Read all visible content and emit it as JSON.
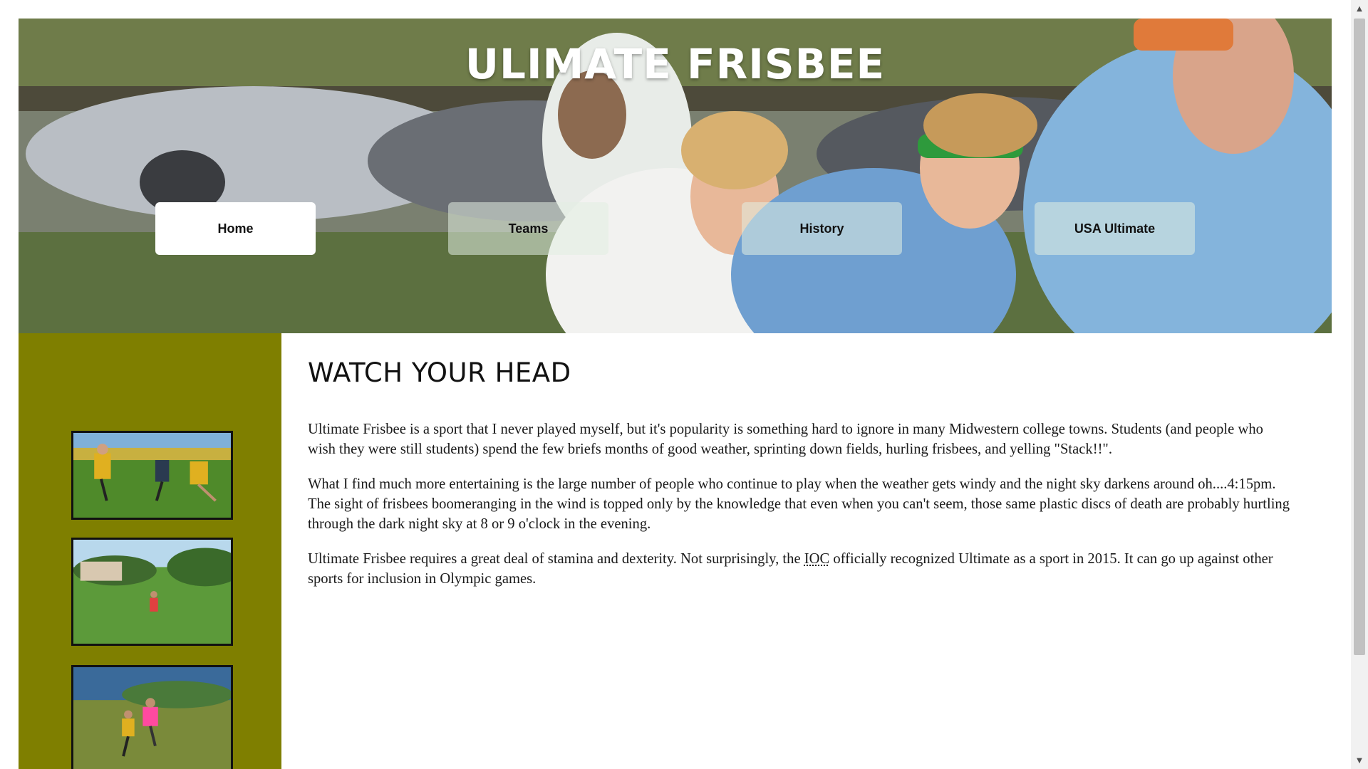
{
  "header": {
    "title": "ULIMATE FRISBEE"
  },
  "nav": {
    "items": [
      {
        "label": "Home",
        "active": true
      },
      {
        "label": "Teams",
        "active": false
      },
      {
        "label": "History",
        "active": false
      },
      {
        "label": "USA Ultimate",
        "active": false
      }
    ]
  },
  "sidebar": {
    "background_color": "#7f7f00",
    "thumbnails": [
      {
        "icon": "frisbee-players-photo"
      },
      {
        "icon": "field-thrower-photo"
      },
      {
        "icon": "disc-catch-photo"
      }
    ]
  },
  "main": {
    "heading": "WATCH YOUR HEAD",
    "paragraphs": [
      "Ultimate Frisbee is a sport that I never played myself, but it's popularity is something hard to ignore in many Midwestern college towns. Students (and people who wish they were still students) spend the few briefs months of good weather, sprinting down fields, hurling frisbees, and yelling \"Stack!!\".",
      "What I find much more entertaining is the large number of people who continue to play when the weather gets windy and the night sky darkens around oh....4:15pm. The sight of frisbees boomeranging in the wind is topped only by the knowledge that even when you can't seem, those same plastic discs of death are probably hurtling through the dark night sky at 8 or 9 o'clock in the evening."
    ],
    "paragraph3": {
      "before": "Ultimate Frisbee requires a great deal of stamina and dexterity. Not surprisingly, the ",
      "abbr": "IOC",
      "after": " officially recognized Ultimate as a sport in 2015. It can go up against other sports for inclusion in Olympic games."
    }
  },
  "scrollbar": {
    "up_arrow": "▲",
    "down_arrow": "▼"
  }
}
